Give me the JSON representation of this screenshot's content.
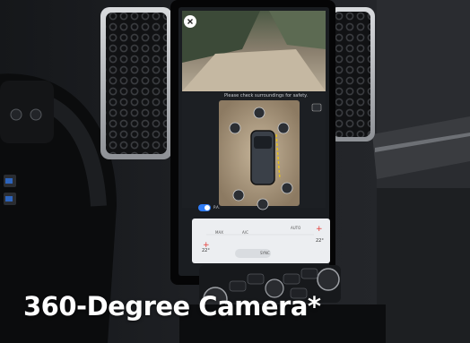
{
  "caption": "360-Degree Camera*",
  "screen": {
    "safety_message": "Please check surroundings for safety.",
    "parking_toggle_label": "P.A.",
    "climate": {
      "left_temp": "22°",
      "right_temp": "22°",
      "max_label": "MAX",
      "ac_label": "A/C",
      "auto_label": "AUTO",
      "sync_label": "SYNC"
    }
  },
  "colors": {
    "accent_blue": "#2f7cf6",
    "temp_red": "#e53935",
    "guide_yellow": "#e8c21a"
  }
}
